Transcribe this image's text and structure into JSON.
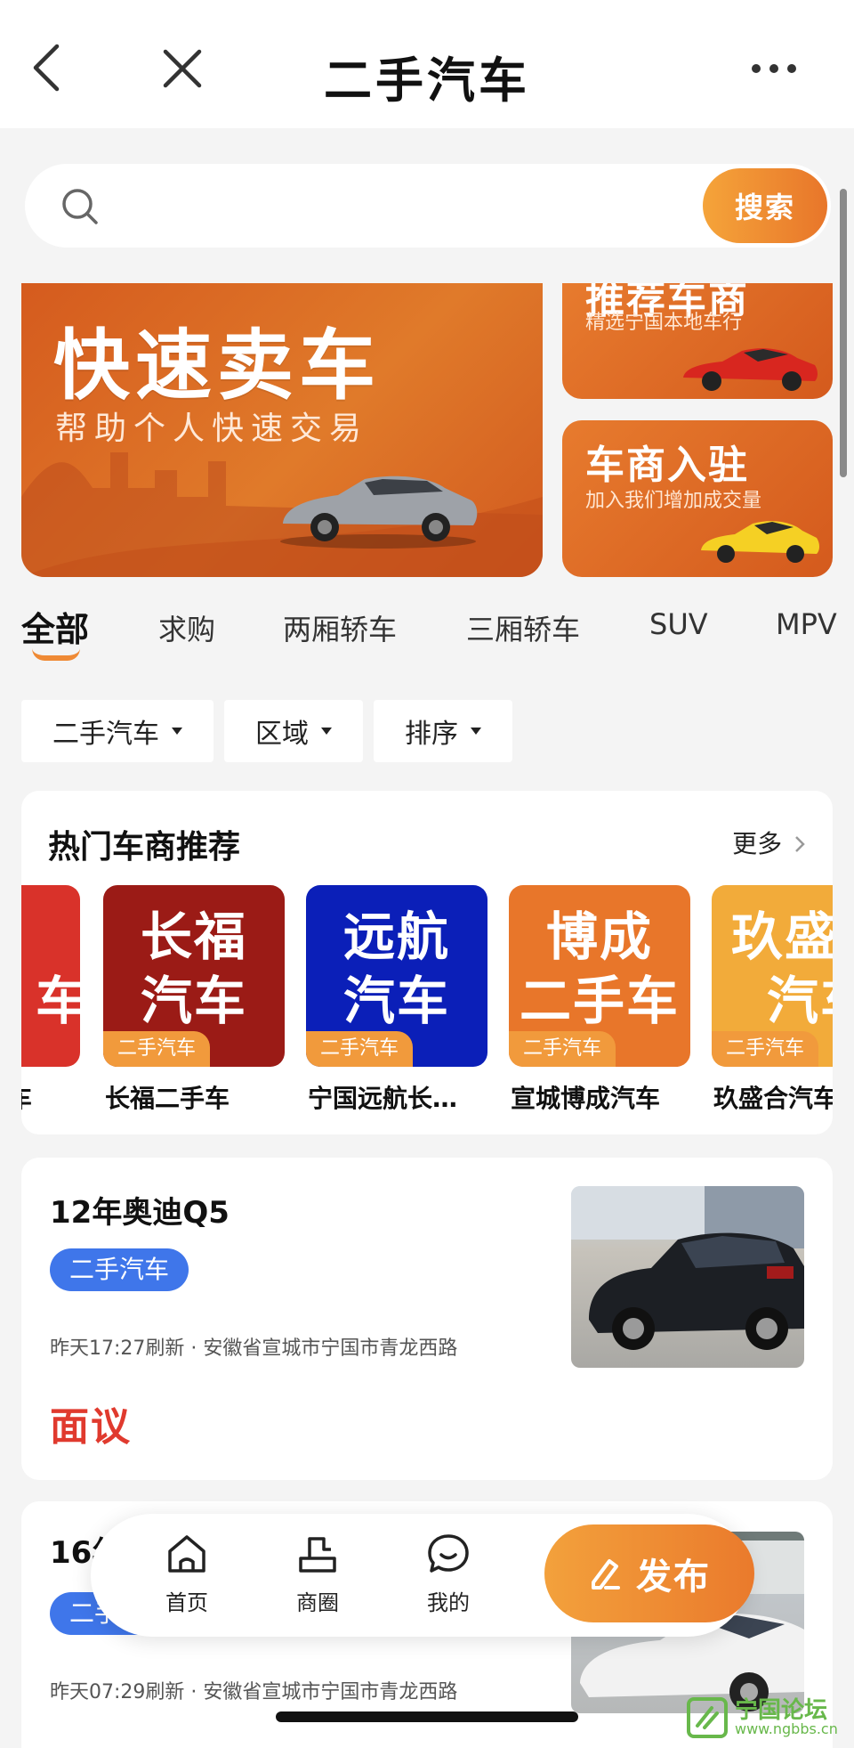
{
  "header": {
    "title": "二手汽车"
  },
  "search": {
    "placeholder": "",
    "button_label": "搜索"
  },
  "banners": {
    "main": {
      "title": "快速卖车",
      "subtitle": "帮助个人快速交易"
    },
    "side1": {
      "title": "推荐车商",
      "subtitle": "精选宁国本地车行"
    },
    "side2": {
      "title": "车商入驻",
      "subtitle": "加入我们增加成交量"
    }
  },
  "tabs": [
    "全部",
    "求购",
    "两厢轿车",
    "三厢轿车",
    "SUV",
    "MPV"
  ],
  "filters": [
    "二手汽车",
    "区域",
    "排序"
  ],
  "dealers": {
    "title": "热门车商推荐",
    "more": "更多",
    "tag": "二手汽车",
    "items": [
      {
        "logo_line1": "",
        "logo_line2": "车",
        "name": "车",
        "color": "#d9322a"
      },
      {
        "logo_line1": "长福",
        "logo_line2": "汽车",
        "name": "长福二手车",
        "color": "#9b1b16"
      },
      {
        "logo_line1": "远航",
        "logo_line2": "汽车",
        "name": "宁国远航长…",
        "color": "#0b1fb8"
      },
      {
        "logo_line1": "博成",
        "logo_line2": "二手车",
        "name": "宣城博成汽车",
        "color": "#e8762a"
      },
      {
        "logo_line1": "玖盛合",
        "logo_line2": "汽车",
        "name": "玖盛合汽车",
        "color": "#f2ab3a"
      }
    ]
  },
  "listings": [
    {
      "title": "12年奥迪Q5",
      "badge": "二手汽车",
      "meta": "昨天17:27刷新 · 安徽省宣城市宁国市青龙西路",
      "price": "面议"
    },
    {
      "title": "16年",
      "badge": "二手汽车",
      "meta": "昨天07:29刷新 · 安徽省宣城市宁国市青龙西路",
      "price": ""
    }
  ],
  "bottom_nav": {
    "items": [
      "首页",
      "商圈",
      "我的"
    ],
    "publish": "发布"
  },
  "watermark": {
    "title": "宁国论坛",
    "url": "www.ngbbs.cn"
  },
  "colors": {
    "accent": "#ef8a35",
    "badge_blue": "#3f76ea",
    "price_red": "#e03a2e"
  }
}
